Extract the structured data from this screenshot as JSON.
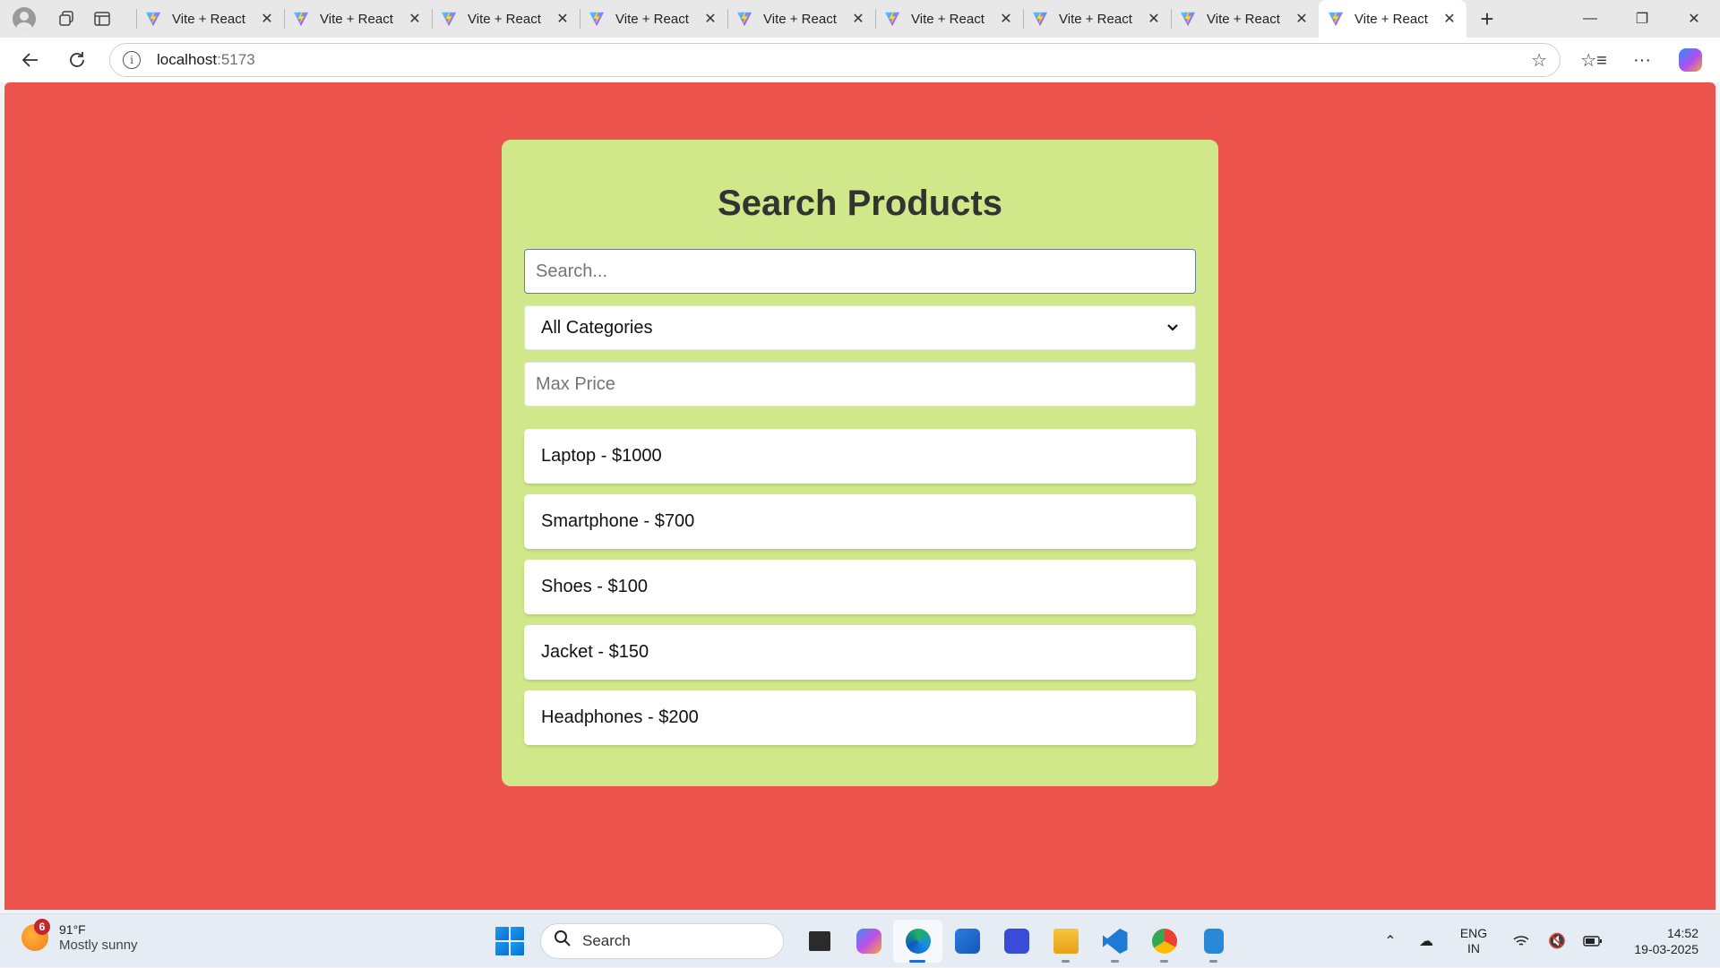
{
  "browser": {
    "tab_title": "Vite + React",
    "tab_count": 9,
    "active_tab_index": 8,
    "url_host": "localhost",
    "url_port": ":5173"
  },
  "page": {
    "background_color": "#eb534c",
    "card_color": "#d1e88a",
    "title": "Search Products",
    "search_placeholder": "Search...",
    "category_selected": "All Categories",
    "max_price_placeholder": "Max Price",
    "products": [
      "Laptop - $1000",
      "Smartphone - $700",
      "Shoes - $100",
      "Jacket - $150",
      "Headphones - $200"
    ]
  },
  "taskbar": {
    "weather_badge": "6",
    "temperature": "91°F",
    "condition": "Mostly sunny",
    "search_label": "Search",
    "lang_top": "ENG",
    "lang_bottom": "IN",
    "time": "14:52",
    "date": "19-03-2025",
    "apps": [
      "file-manager-icon",
      "copilot-icon",
      "edge-icon",
      "store-icon",
      "mathpix-icon",
      "explorer-icon",
      "vscode-icon",
      "chrome-icon",
      "notepad-icon"
    ]
  }
}
